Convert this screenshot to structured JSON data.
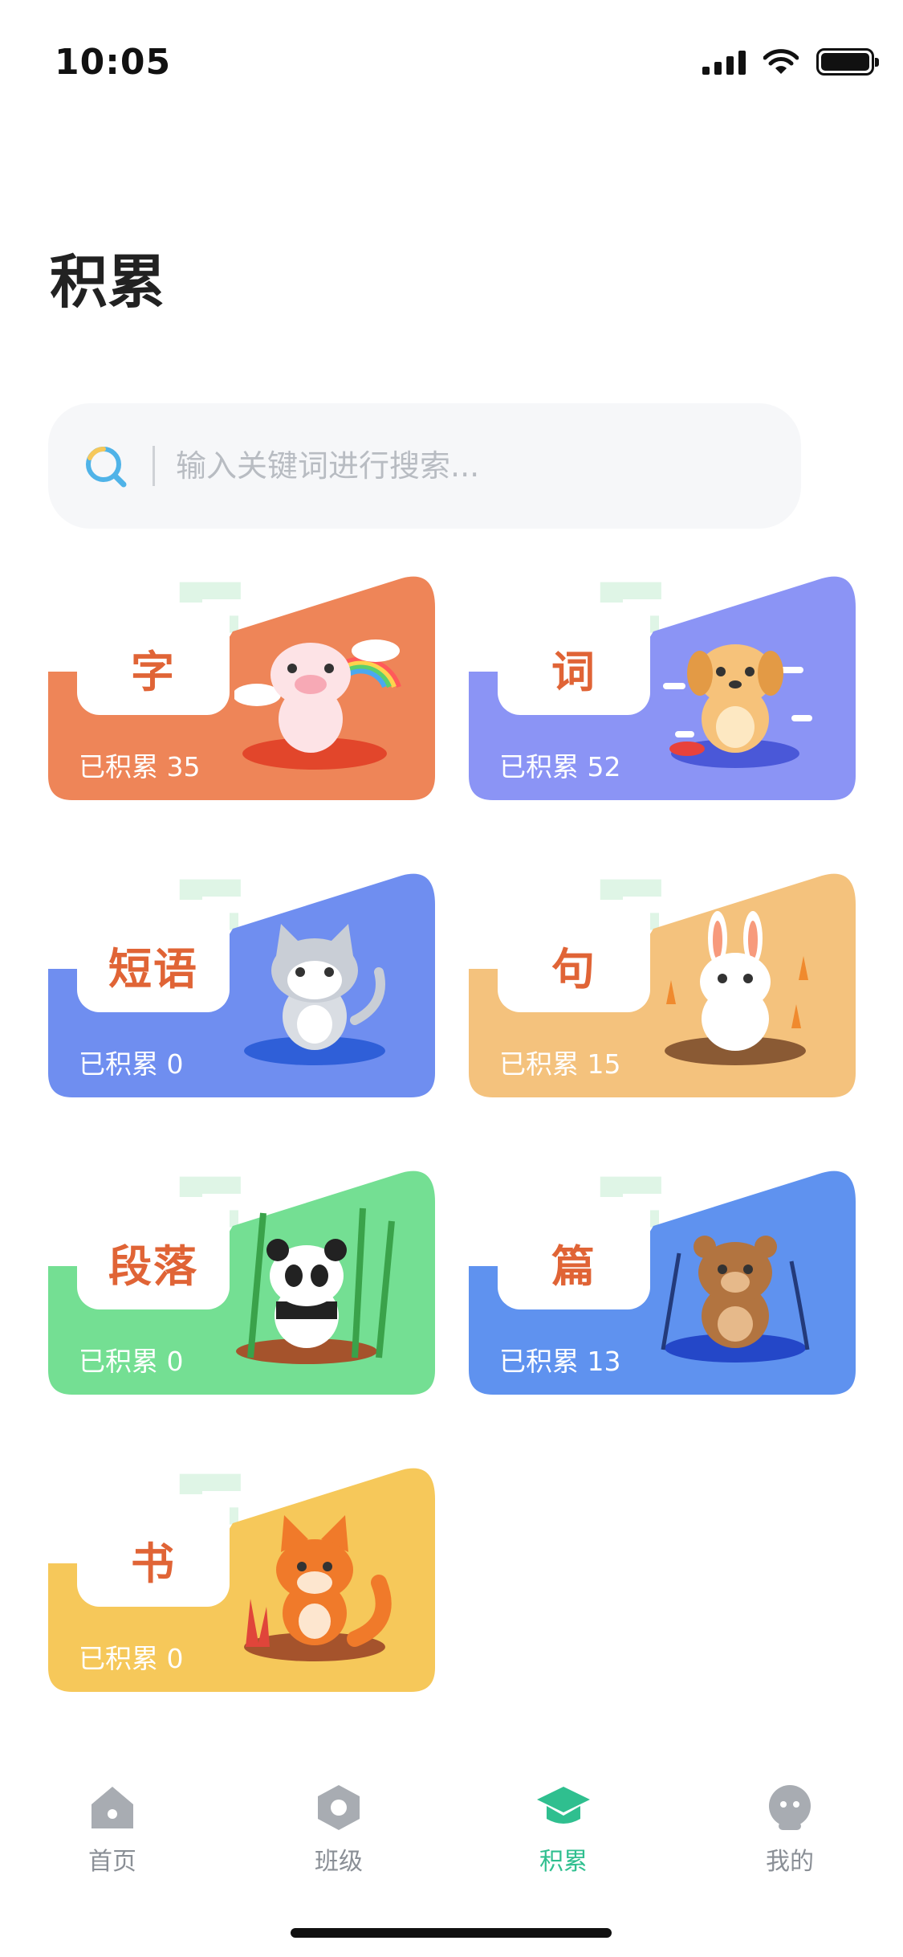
{
  "status_bar": {
    "time": "10:05"
  },
  "page": {
    "title": "积累"
  },
  "search": {
    "placeholder": "输入关键词进行搜索..."
  },
  "cards": [
    {
      "label": "字",
      "count_text": "已积累 35",
      "color": "#ee8558",
      "animal": "pig-icon"
    },
    {
      "label": "词",
      "count_text": "已积累 52",
      "color": "#8b94f5",
      "animal": "dog-icon"
    },
    {
      "label": "短语",
      "count_text": "已积累 0",
      "color": "#6f8ef0",
      "animal": "cat-icon"
    },
    {
      "label": "句",
      "count_text": "已积累 15",
      "color": "#f4c27d",
      "animal": "rabbit-icon"
    },
    {
      "label": "段落",
      "count_text": "已积累 0",
      "color": "#74df93",
      "animal": "panda-icon"
    },
    {
      "label": "篇",
      "count_text": "已积累 13",
      "color": "#5f92ef",
      "animal": "bear-icon"
    },
    {
      "label": "书",
      "count_text": "已积累 0",
      "color": "#f6c85a",
      "animal": "fox-icon"
    }
  ],
  "tab_bar": {
    "items": [
      {
        "label": "首页",
        "icon": "home-icon"
      },
      {
        "label": "班级",
        "icon": "class-icon"
      },
      {
        "label": "积累",
        "icon": "graduation-cap-icon",
        "active": true
      },
      {
        "label": "我的",
        "icon": "profile-icon"
      }
    ],
    "accent_color": "#2fbf8f"
  }
}
